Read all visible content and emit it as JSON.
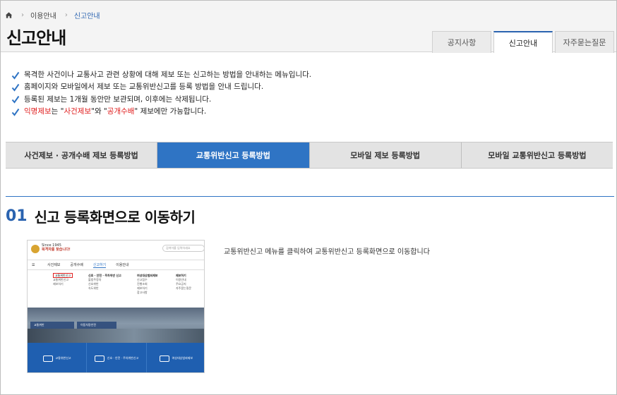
{
  "breadcrumb": {
    "home_icon": "home-icon",
    "items": [
      "이용안내",
      "신고안내"
    ]
  },
  "page_title": "신고안내",
  "tabs": [
    {
      "label": "공지사항"
    },
    {
      "label": "신고안내",
      "active": true
    },
    {
      "label": "자주묻는질문"
    }
  ],
  "notices": [
    "목격한 사건이나 교통사고 관련 상황에 대해 제보 또는 신고하는 방법을 안내하는 메뉴입니다.",
    "홈페이지와 모바일에서 제보 또는 교통위반신고를 등록 방법을 안내 드립니다.",
    "등록된 제보는 1개월 동안만 보관되며, 이후에는 삭제됩니다."
  ],
  "notice_last": {
    "part1": "익명제보",
    "part2": "는 \"",
    "part3": "사건제보",
    "part4": "\"와 \"",
    "part5": "공개수배",
    "part6": "\" 제보에만 가능합니다."
  },
  "methods": [
    {
      "label": "사건제보 · 공개수배 제보 등록방법"
    },
    {
      "label": "교통위반신고 등록방법",
      "active": true
    },
    {
      "label": "모바일 제보 등록방법"
    },
    {
      "label": "모바일 교통위반신고 등록방법"
    }
  ],
  "step": {
    "number": "01",
    "title": "신고 등록화면으로 이동하기",
    "description": "교통위반신고 메뉴를 클릭하여 교통위반신고 등록화면으로 이동합니다"
  },
  "thumbnail": {
    "logo_text_1": "Since 1945",
    "logo_text_2": "목격자를 찾습니다!",
    "search_placeholder": "검색어를 입력하세요",
    "nav": [
      "사건제보",
      "공개수배",
      "신고하기",
      "이용안내"
    ],
    "col1": [
      "교통위반신고",
      "교통위반신고",
      "제보하기"
    ],
    "col2_head": "신호 · 안전 · 주차위반 신고",
    "col2": [
      "불법주정차",
      "신호위반",
      "속도위반"
    ],
    "col3_head": "여성대상범죄제보",
    "col3": [
      "신고접수",
      "진행조회",
      "제보하기",
      "참고사항"
    ],
    "col4_head": "제보하기",
    "col4": [
      "이용안내",
      "주요공지",
      "자주묻는질문"
    ],
    "hero_btn_1": "교통위반",
    "hero_btn_2": "이동차량안전",
    "bottom": [
      "교통위반신고",
      "신호 · 안전 · 주차위반신고",
      "여성대상범죄제보"
    ]
  },
  "colors": {
    "accent": "#2f74c4",
    "red": "#e02020"
  }
}
